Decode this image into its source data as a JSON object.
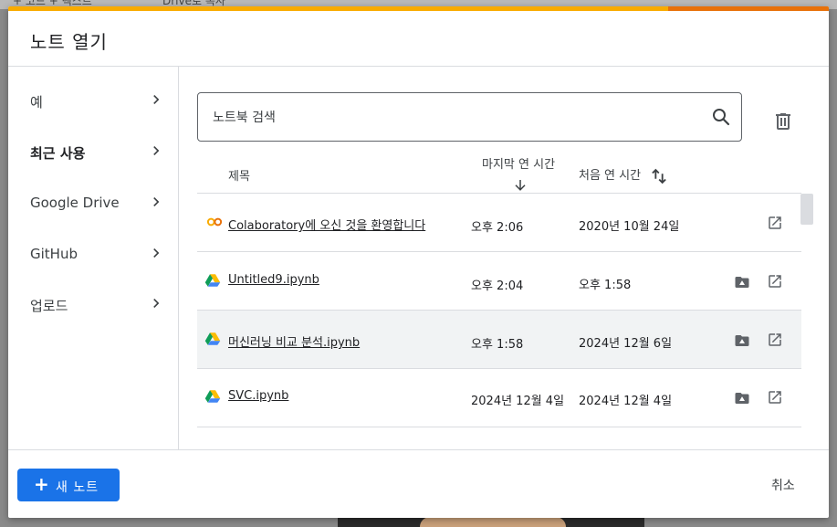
{
  "background": {
    "tab_left": "+ 코드  + 텍스트",
    "tab_right": "Drive로 복사"
  },
  "dialog": {
    "title": "노트 열기",
    "accent_color": "#f9ab00",
    "accent_end_color": "#e8710a"
  },
  "sidebar": {
    "items": [
      {
        "label": "예",
        "active": false
      },
      {
        "label": "최근 사용",
        "active": true
      },
      {
        "label": "Google Drive",
        "active": false
      },
      {
        "label": "GitHub",
        "active": false
      },
      {
        "label": "업로드",
        "active": false
      }
    ]
  },
  "search": {
    "placeholder": "노트북 검색",
    "value": ""
  },
  "table": {
    "headers": {
      "title": "제목",
      "last_opened": "마지막 연 시간",
      "first_opened": "처음 연 시간"
    },
    "rows": [
      {
        "icon": "colab-icon",
        "name": "Colaboratory에 오신 것을 환영합니다",
        "last_opened": "오후 2:06",
        "first_opened": "2020년 10월 24일",
        "drive_action": false
      },
      {
        "icon": "google-drive-icon",
        "name": "Untitled9.ipynb",
        "last_opened": "오후 2:04",
        "first_opened": "오후 1:58",
        "drive_action": true
      },
      {
        "icon": "google-drive-icon",
        "name": "머신러닝 비교 분석.ipynb",
        "last_opened": "오후 1:58",
        "first_opened": "2024년 12월 6일",
        "drive_action": true
      },
      {
        "icon": "google-drive-icon",
        "name": "SVC.ipynb",
        "last_opened": "2024년 12월 4일",
        "first_opened": "2024년 12월 4일",
        "drive_action": true
      }
    ]
  },
  "footer": {
    "new_note_label": "새 노트",
    "cancel_label": "취소",
    "primary_color": "#1a73e8"
  }
}
